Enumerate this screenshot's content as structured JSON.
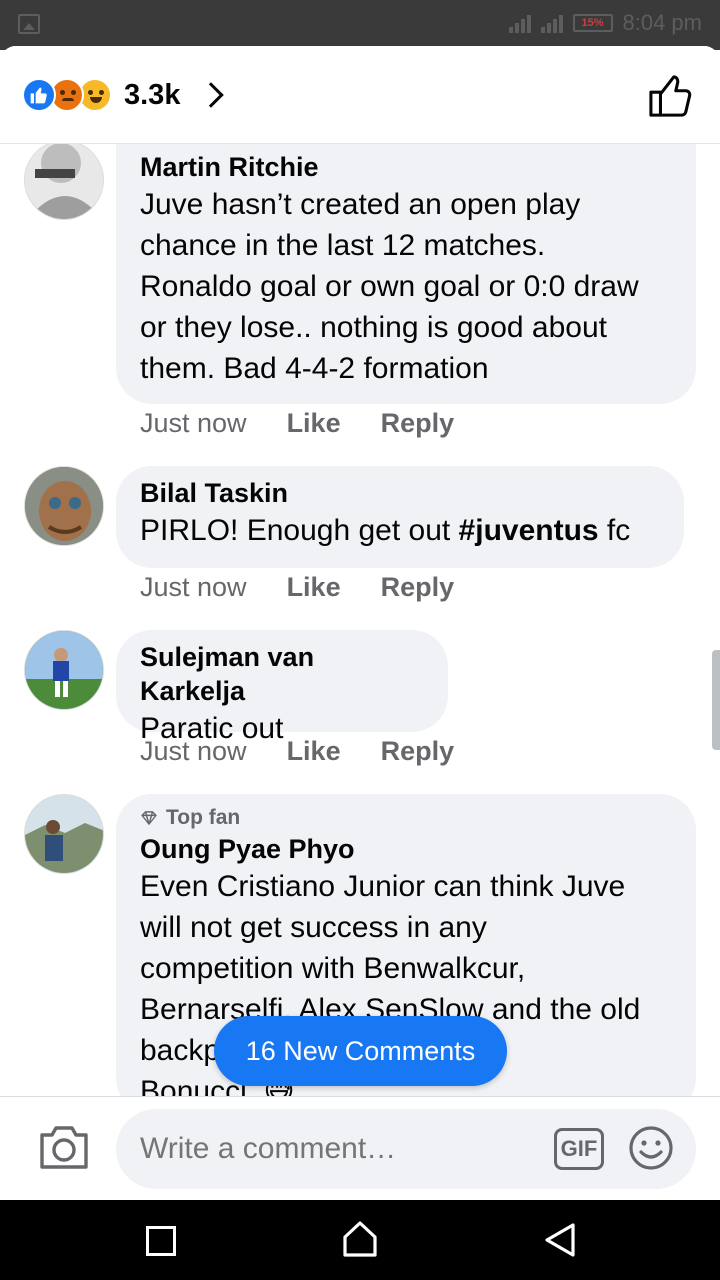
{
  "status_bar": {
    "battery": "15%",
    "time": "8:04 pm"
  },
  "header": {
    "reaction_count": "3.3k",
    "reactions": [
      "like-icon",
      "angry-icon",
      "haha-icon"
    ]
  },
  "comments": [
    {
      "author": "Martin Ritchie",
      "lines": [
        "Juve hasn’t created an open play",
        "chance in the last 12 matches.",
        "Ronaldo goal or own goal or 0:0 draw",
        "or they lose.. nothing is good about",
        "them. Bad 4-4-2 formation"
      ],
      "time": "Just now",
      "like": "Like",
      "reply": "Reply"
    },
    {
      "author": "Bilal Taskin",
      "text_before": "PIRLO! Enough get out  ",
      "hashtag": "#juventus",
      "text_after": " fc",
      "time": "Just now",
      "like": "Like",
      "reply": "Reply"
    },
    {
      "author": "Sulejman van Karkelja",
      "text": "Paratic out",
      "time": "Just now",
      "like": "Like",
      "reply": "Reply"
    },
    {
      "badge": "Top fan",
      "author": "Oung Pyae Phyo",
      "lines": [
        "Even Cristiano Junior can think Juve",
        "will not get success in any",
        "competition with Benwalkcur,",
        "Bernarselfi, Alex SenSlow and the old",
        "backpain Chiellini and",
        "Bonucci. 😅"
      ]
    }
  ],
  "new_comments_button": "16 New Comments",
  "composer": {
    "placeholder": "Write a comment…",
    "gif_label": "GIF"
  }
}
